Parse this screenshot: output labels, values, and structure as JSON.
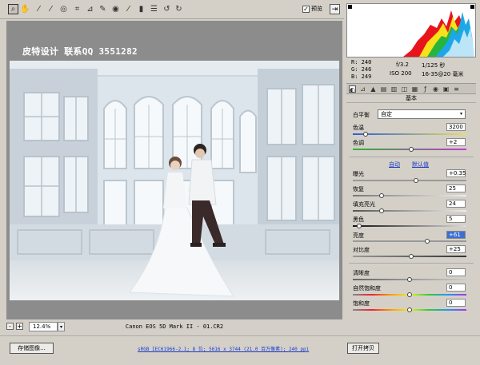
{
  "toolbar": {
    "tools": [
      {
        "name": "zoom-tool-icon",
        "glyph": "⌕",
        "active": true
      },
      {
        "name": "hand-tool-icon",
        "glyph": "✋"
      },
      {
        "name": "white-balance-tool-icon",
        "glyph": "⁄"
      },
      {
        "name": "color-sampler-tool-icon",
        "glyph": "⁄"
      },
      {
        "name": "targeted-adjustment-tool-icon",
        "glyph": "◎"
      },
      {
        "name": "crop-tool-icon",
        "glyph": "⌗"
      },
      {
        "name": "straighten-tool-icon",
        "glyph": "⊿"
      },
      {
        "name": "spot-removal-tool-icon",
        "glyph": "✎"
      },
      {
        "name": "red-eye-tool-icon",
        "glyph": "◉"
      },
      {
        "name": "adjustment-brush-icon",
        "glyph": "⁄"
      },
      {
        "name": "graduated-filter-icon",
        "glyph": "▮"
      },
      {
        "name": "preferences-icon",
        "glyph": "☰"
      },
      {
        "name": "rotate-left-icon",
        "glyph": "↺"
      },
      {
        "name": "rotate-right-icon",
        "glyph": "↻"
      }
    ],
    "preview_label": "预览",
    "preview_checked": "✓",
    "fullscreen_glyph": "⇥"
  },
  "watermark": "皮特设计 联系QQ 3551282",
  "zoom": {
    "minus": "-",
    "plus": "+",
    "value": "12.4%",
    "arrow": "▾"
  },
  "camera_info": "Canon EOS 5D Mark II - 01.CR2",
  "info": {
    "r": "R:  240",
    "g": "G:  246",
    "b": "B:  249",
    "aperture": "f/3.2",
    "shutter": "1/125 秒",
    "iso": "ISO 200",
    "lens": "16-35@20 毫米"
  },
  "panel_title": "基本",
  "basic": {
    "wb_label": "白平衡",
    "wb_value": "自定",
    "wb_arrow": "▾",
    "temp_label": "色温",
    "temp_value": "3200",
    "tint_label": "色调",
    "tint_value": "+2",
    "auto_link": "自动",
    "default_link": "默认值",
    "exposure_label": "曝光",
    "exposure_value": "+0.35",
    "recovery_label": "恢复",
    "recovery_value": "25",
    "fill_label": "填充亮光",
    "fill_value": "24",
    "black_label": "黑色",
    "black_value": "5",
    "brightness_label": "亮度",
    "brightness_value": "+61",
    "contrast_label": "对比度",
    "contrast_value": "+25",
    "clarity_label": "清晰度",
    "clarity_value": "0",
    "vibrance_label": "自然饱和度",
    "vibrance_value": "0",
    "saturation_label": "饱和度",
    "saturation_value": "0"
  },
  "bottom": {
    "save_label": "存储图像...",
    "workflow": "sRGB IEC61966-2.1; 8 位; 5616 x 3744 (21.0 百万像素); 240 ppi",
    "open_label": "打开拷贝"
  }
}
